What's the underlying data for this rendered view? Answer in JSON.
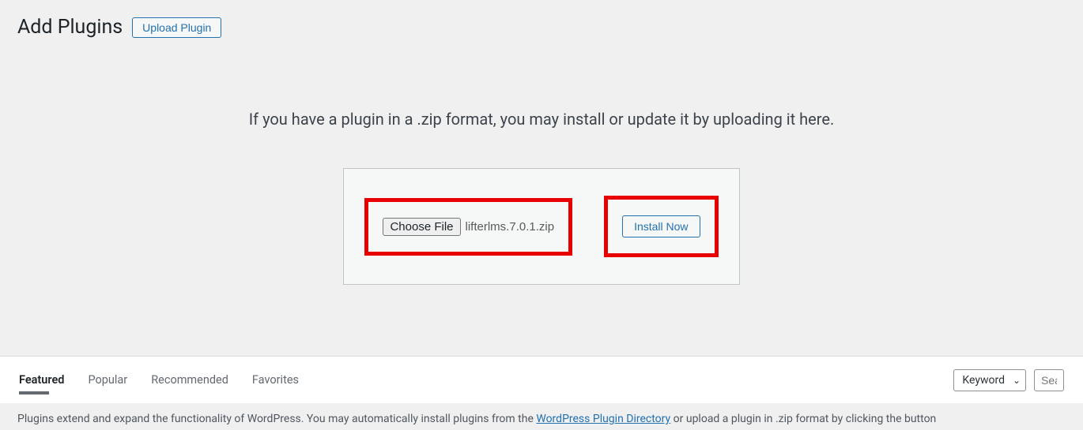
{
  "header": {
    "title": "Add Plugins",
    "upload_button": "Upload Plugin"
  },
  "upload_panel": {
    "instructions": "If you have a plugin in a .zip format, you may install or update it by uploading it here.",
    "choose_file_label": "Choose File",
    "selected_file": "lifterlms.7.0.1.zip",
    "install_button": "Install Now"
  },
  "tabs": {
    "items": [
      {
        "label": "Featured",
        "active": true
      },
      {
        "label": "Popular",
        "active": false
      },
      {
        "label": "Recommended",
        "active": false
      },
      {
        "label": "Favorites",
        "active": false
      }
    ]
  },
  "search": {
    "keyword_label": "Keyword",
    "placeholder": "Sear"
  },
  "footer": {
    "text_before": "Plugins extend and expand the functionality of WordPress. You may automatically install plugins from the ",
    "link_text": "WordPress Plugin Directory",
    "text_after": " or upload a plugin in .zip format by clicking the button"
  }
}
